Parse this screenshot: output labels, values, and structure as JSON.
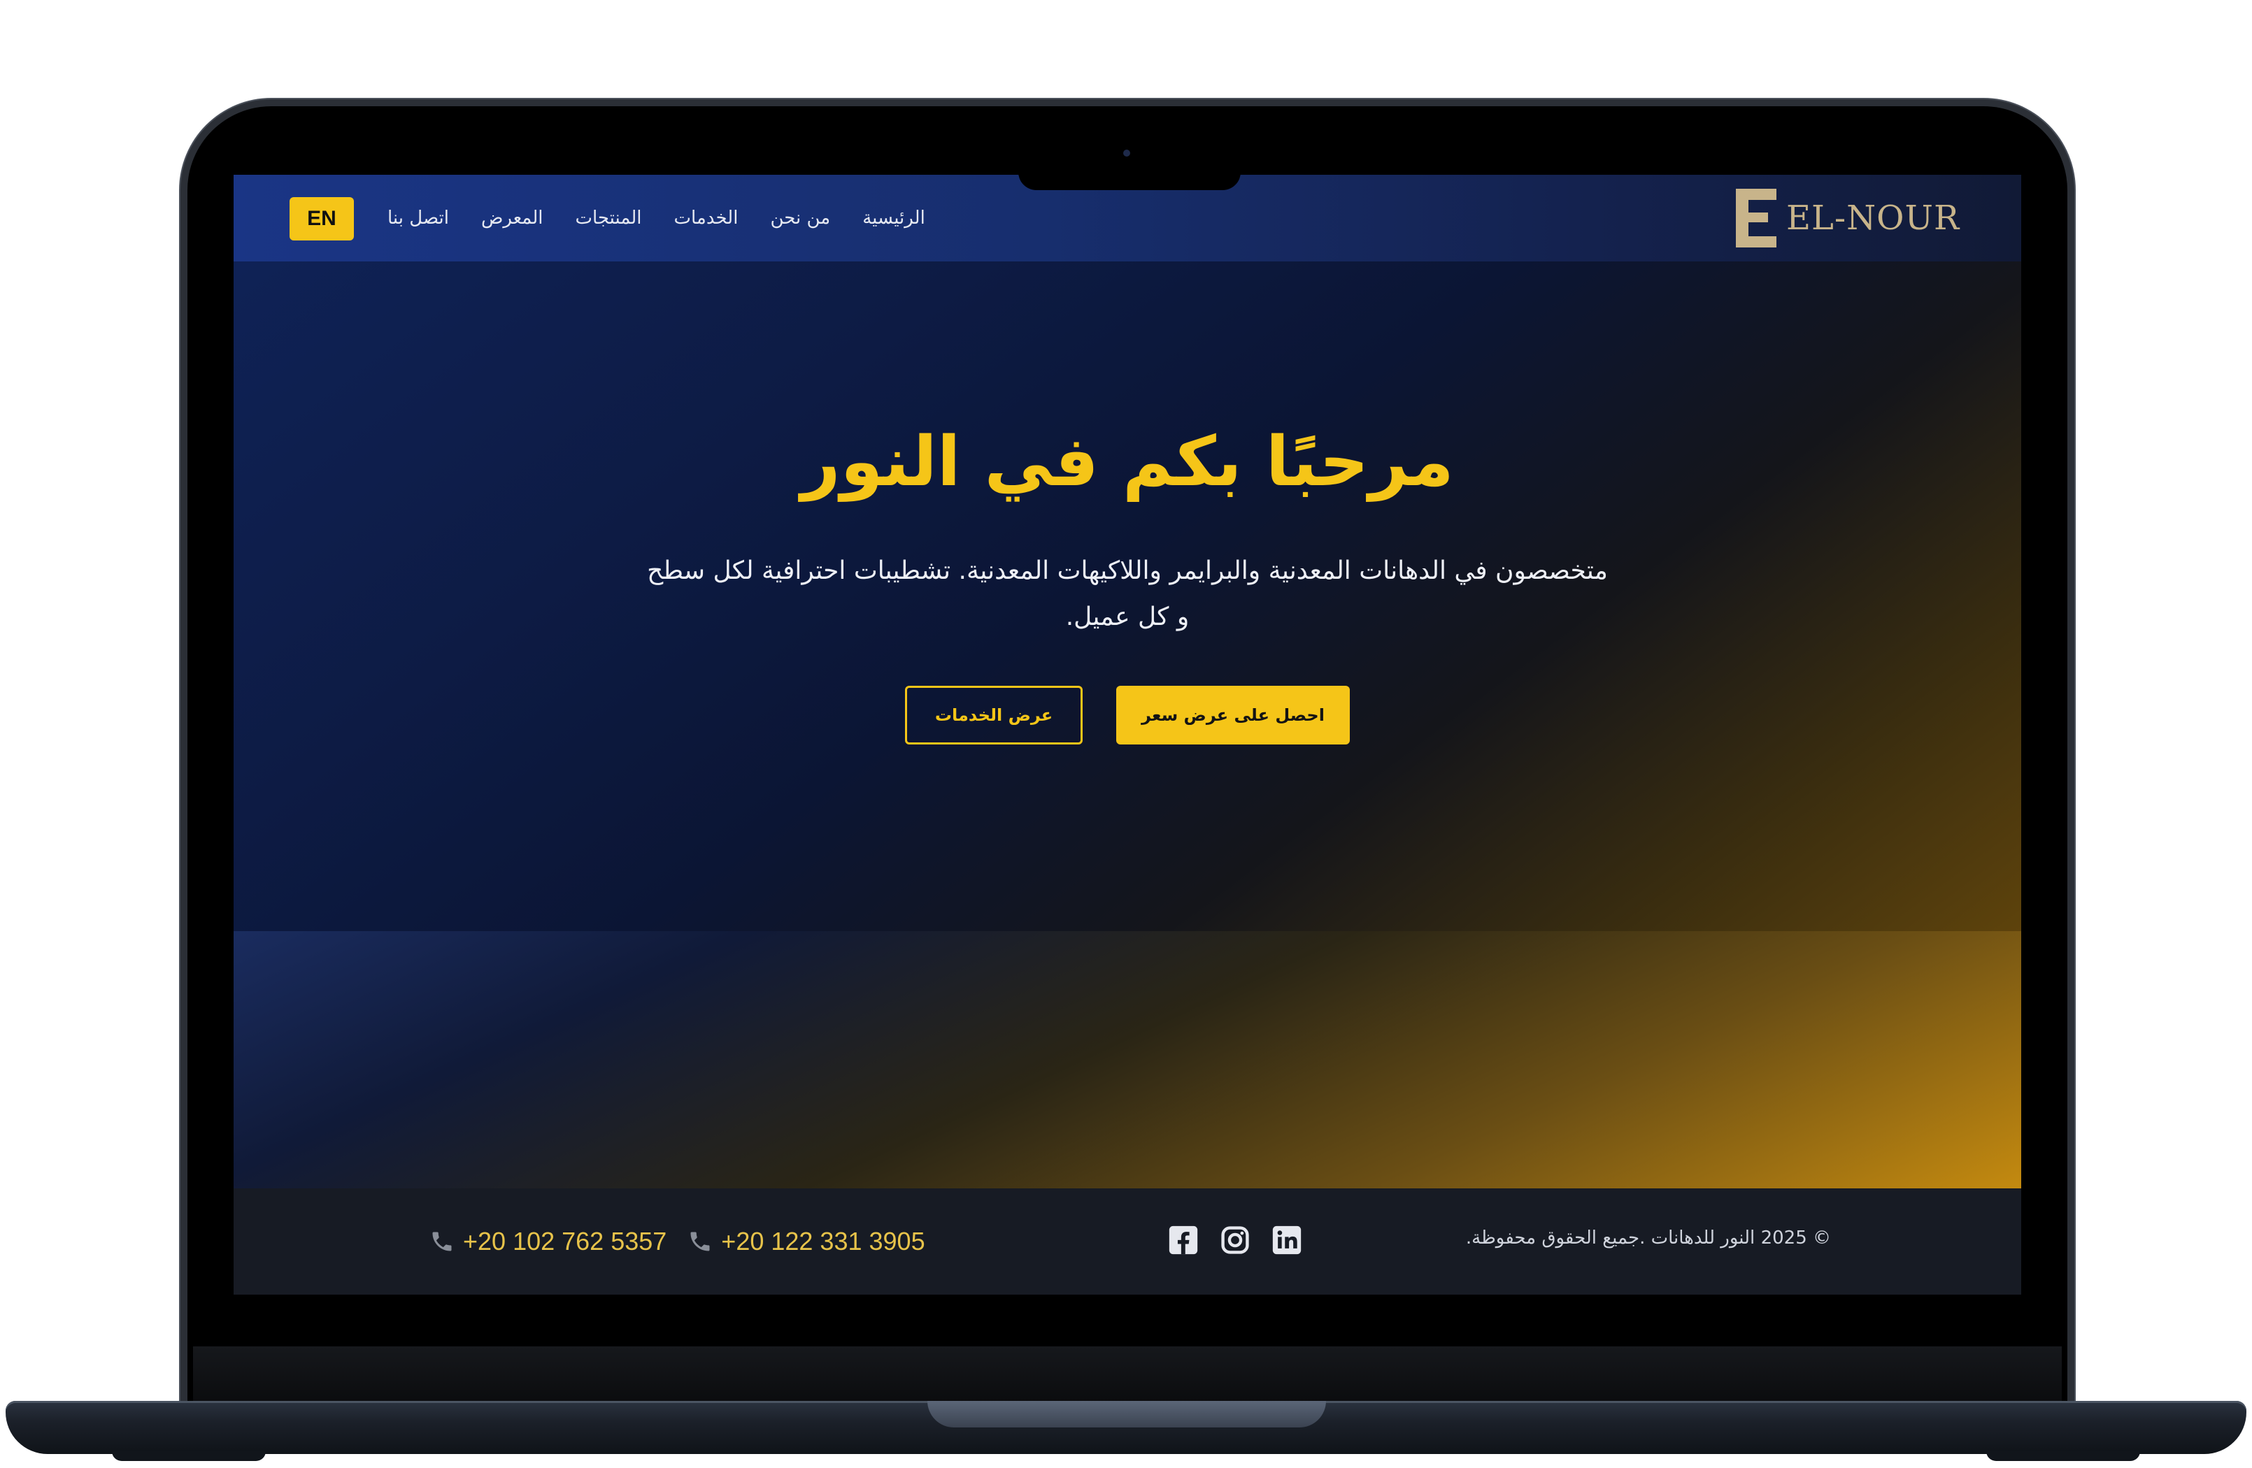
{
  "brand": {
    "logo_text": "EL-NOUR",
    "logo_letter": "E",
    "accent": "#f5c518",
    "logo_color": "#c8b48a"
  },
  "nav": {
    "links": [
      "الرئيسية",
      "من نحن",
      "الخدمات",
      "المنتجات",
      "المعرض",
      "اتصل بنا"
    ],
    "lang_button": "EN"
  },
  "hero": {
    "title": "مرحبًا بكم في النور",
    "subtitle": "متخصصون في الدهانات المعدنية والبرايمر واللاكيهات المعدنية. تشطيبات احترافية لكل سطح و كل عميل.",
    "primary_button": "احصل على عرض سعر",
    "secondary_button": "عرض الخدمات"
  },
  "footer": {
    "phones": [
      "+20 102 762 5357",
      "+20 122 331 3905"
    ],
    "social_icons": [
      "facebook-icon",
      "instagram-icon",
      "linkedin-icon"
    ],
    "copyright": "© 2025 النور للدهانات .جميع الحقوق محفوظة."
  }
}
